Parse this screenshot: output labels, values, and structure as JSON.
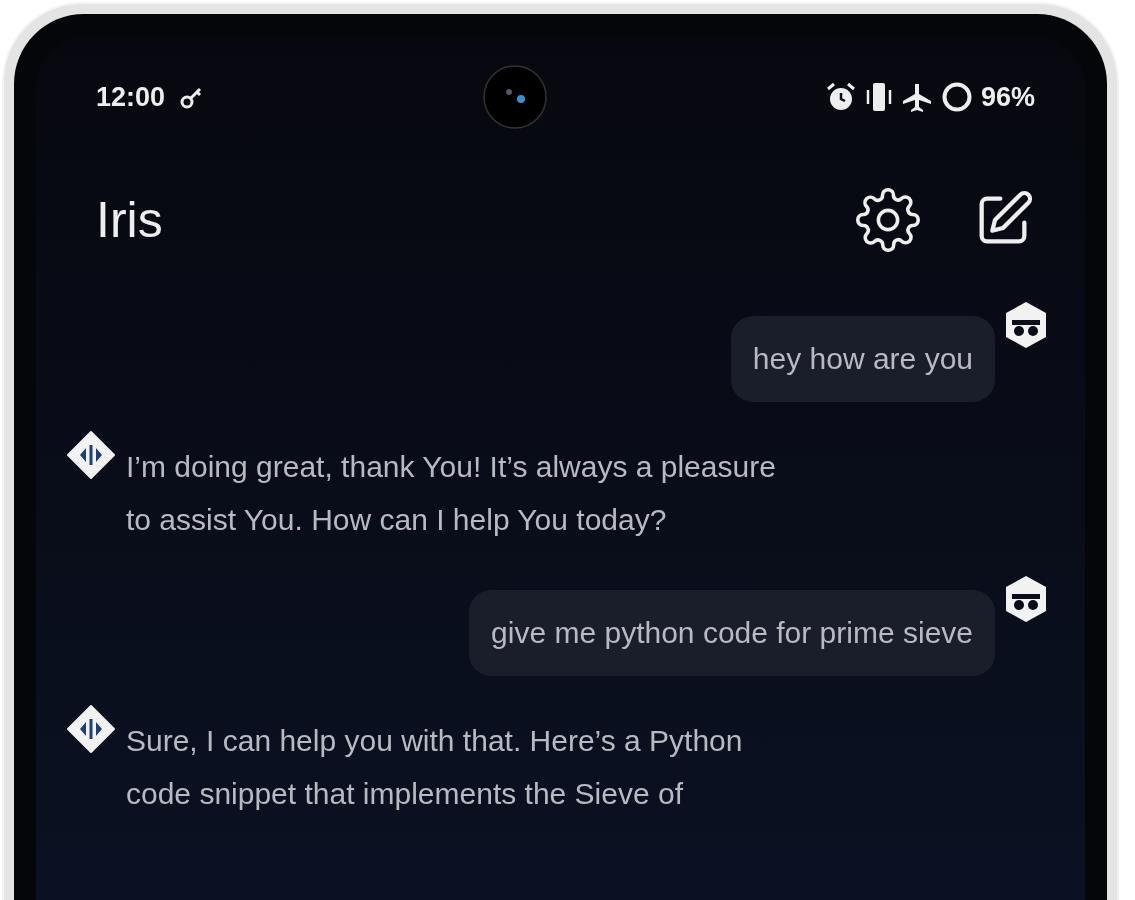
{
  "status_bar": {
    "time": "12:00",
    "battery": "96%"
  },
  "header": {
    "title": "Iris"
  },
  "messages": [
    {
      "kind": "user",
      "text": "hey how are you"
    },
    {
      "kind": "assistant",
      "text": "I’m doing great, thank You! It’s always a pleasure to assist You. How can I help You today?"
    },
    {
      "kind": "user",
      "text": "give me python code for prime sieve"
    },
    {
      "kind": "assistant",
      "text": "Sure, I can help you with that. Here’s a Python code snippet that implements the Sieve of"
    }
  ]
}
